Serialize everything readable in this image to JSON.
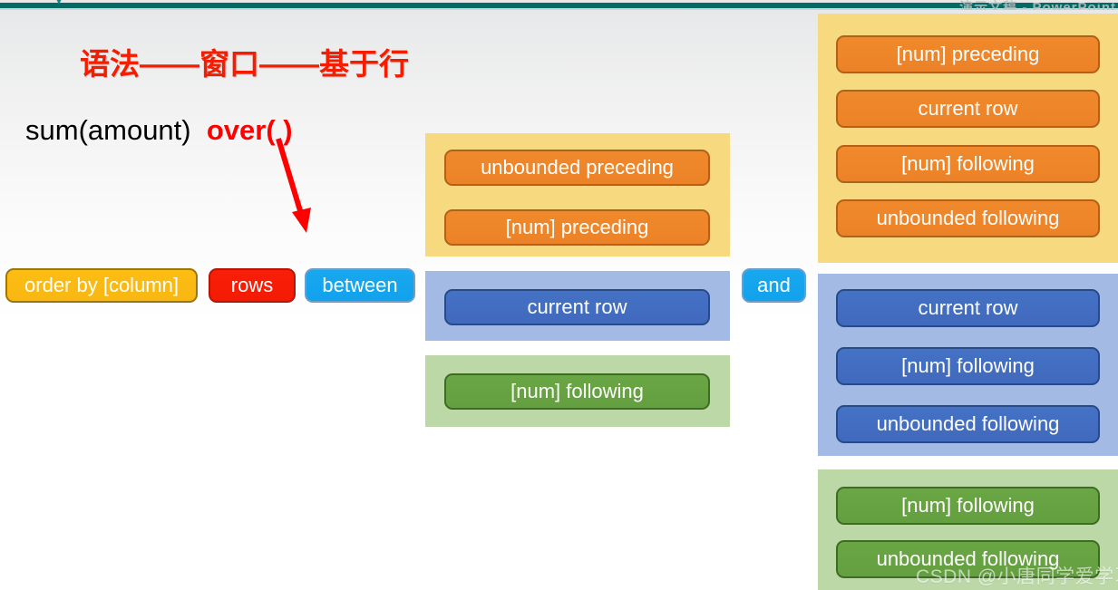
{
  "topbar": {
    "chevron_icon": "chevron-down-icon",
    "ghost_text": "演示文稿 - PowerPoint"
  },
  "slide": {
    "title": "语法——窗口——基于行",
    "formula": {
      "expression": "sum(amount)",
      "over_keyword": "over( )"
    },
    "arrow": {
      "name": "red-down-right-arrow",
      "color": "#ff0000"
    }
  },
  "clause_chain": {
    "order_by": "order by [column]",
    "rows": "rows",
    "between": "between",
    "and": "and"
  },
  "colors": {
    "panel_yellow": "#f7d97f",
    "panel_blue": "#a3bbe4",
    "panel_green": "#bbd8a6",
    "pill_orange": "#ec8227",
    "pill_blue": "#4472c4",
    "pill_green": "#649f40",
    "pill_amber": "#f9b711",
    "pill_red": "#f41b05",
    "pill_cyan": "#12a2ec",
    "title_red": "#f51c00",
    "topbar_teal": "#046a66"
  },
  "start_bound_groups": [
    {
      "group": "preceding-group",
      "tone": "yellow",
      "items": [
        "unbounded preceding",
        "[num] preceding"
      ]
    },
    {
      "group": "current-row-group",
      "tone": "blue",
      "items": [
        "current row"
      ]
    },
    {
      "group": "following-group",
      "tone": "green",
      "items": [
        "[num] following"
      ]
    }
  ],
  "end_bound_groups": [
    {
      "group": "end-after-preceding",
      "tone": "yellow",
      "items": [
        "[num] preceding",
        "current row",
        "[num] following",
        "unbounded following"
      ]
    },
    {
      "group": "end-after-current-row",
      "tone": "blue",
      "items": [
        "current row",
        "[num] following",
        "unbounded following"
      ]
    },
    {
      "group": "end-after-following",
      "tone": "green",
      "items": [
        "[num] following",
        "unbounded following"
      ]
    }
  ],
  "watermark": "CSDN @小唐同学爱学习"
}
